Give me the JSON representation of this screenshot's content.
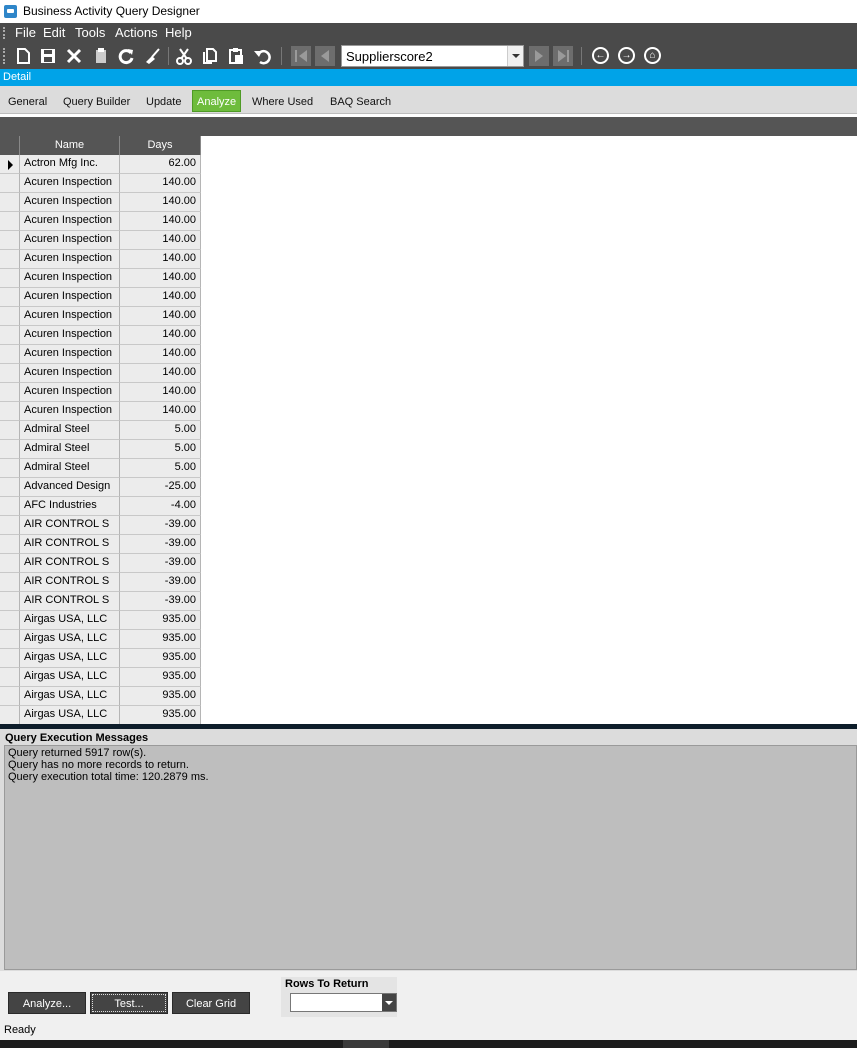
{
  "window": {
    "title": "Business Activity Query Designer"
  },
  "menu": [
    "File",
    "Edit",
    "Tools",
    "Actions",
    "Help"
  ],
  "toolbar": {
    "query_selector_value": "Supplierscore2"
  },
  "detail_header": "Detail",
  "tabs": [
    {
      "label": "General",
      "active": false
    },
    {
      "label": "Query Builder",
      "active": false
    },
    {
      "label": "Update",
      "active": false
    },
    {
      "label": "Analyze",
      "active": true
    },
    {
      "label": "Where Used",
      "active": false
    },
    {
      "label": "BAQ Search",
      "active": false
    }
  ],
  "grid": {
    "columns": [
      "Name",
      "Days"
    ],
    "rows": [
      {
        "name": "Actron Mfg Inc.",
        "days": "62.00",
        "current": true
      },
      {
        "name": "Acuren Inspection",
        "days": "140.00"
      },
      {
        "name": "Acuren Inspection",
        "days": "140.00"
      },
      {
        "name": "Acuren Inspection",
        "days": "140.00"
      },
      {
        "name": "Acuren Inspection",
        "days": "140.00"
      },
      {
        "name": "Acuren Inspection",
        "days": "140.00"
      },
      {
        "name": "Acuren Inspection",
        "days": "140.00"
      },
      {
        "name": "Acuren Inspection",
        "days": "140.00"
      },
      {
        "name": "Acuren Inspection",
        "days": "140.00"
      },
      {
        "name": "Acuren Inspection",
        "days": "140.00"
      },
      {
        "name": "Acuren Inspection",
        "days": "140.00"
      },
      {
        "name": "Acuren Inspection",
        "days": "140.00"
      },
      {
        "name": "Acuren Inspection",
        "days": "140.00"
      },
      {
        "name": "Acuren Inspection",
        "days": "140.00"
      },
      {
        "name": "Admiral Steel",
        "days": "5.00"
      },
      {
        "name": "Admiral Steel",
        "days": "5.00"
      },
      {
        "name": "Admiral Steel",
        "days": "5.00"
      },
      {
        "name": "Advanced Design",
        "days": "-25.00"
      },
      {
        "name": "AFC Industries",
        "days": "-4.00"
      },
      {
        "name": "AIR CONTROL S",
        "days": "-39.00"
      },
      {
        "name": "AIR CONTROL S",
        "days": "-39.00"
      },
      {
        "name": "AIR CONTROL S",
        "days": "-39.00"
      },
      {
        "name": "AIR CONTROL S",
        "days": "-39.00"
      },
      {
        "name": "AIR CONTROL S",
        "days": "-39.00"
      },
      {
        "name": "Airgas USA, LLC",
        "days": "935.00"
      },
      {
        "name": "Airgas USA, LLC",
        "days": "935.00"
      },
      {
        "name": "Airgas USA, LLC",
        "days": "935.00"
      },
      {
        "name": "Airgas USA, LLC",
        "days": "935.00"
      },
      {
        "name": "Airgas USA, LLC",
        "days": "935.00"
      },
      {
        "name": "Airgas USA, LLC",
        "days": "935.00"
      }
    ]
  },
  "messages": {
    "title": "Query Execution Messages",
    "lines": [
      "Query returned 5917 row(s).",
      "Query has no more records to return.",
      "Query execution total time: 120.2879 ms."
    ]
  },
  "buttons": {
    "analyze": "Analyze...",
    "test": "Test...",
    "clear_grid": "Clear Grid"
  },
  "rows_to_return": {
    "label": "Rows To Return",
    "value": ""
  },
  "status": "Ready"
}
